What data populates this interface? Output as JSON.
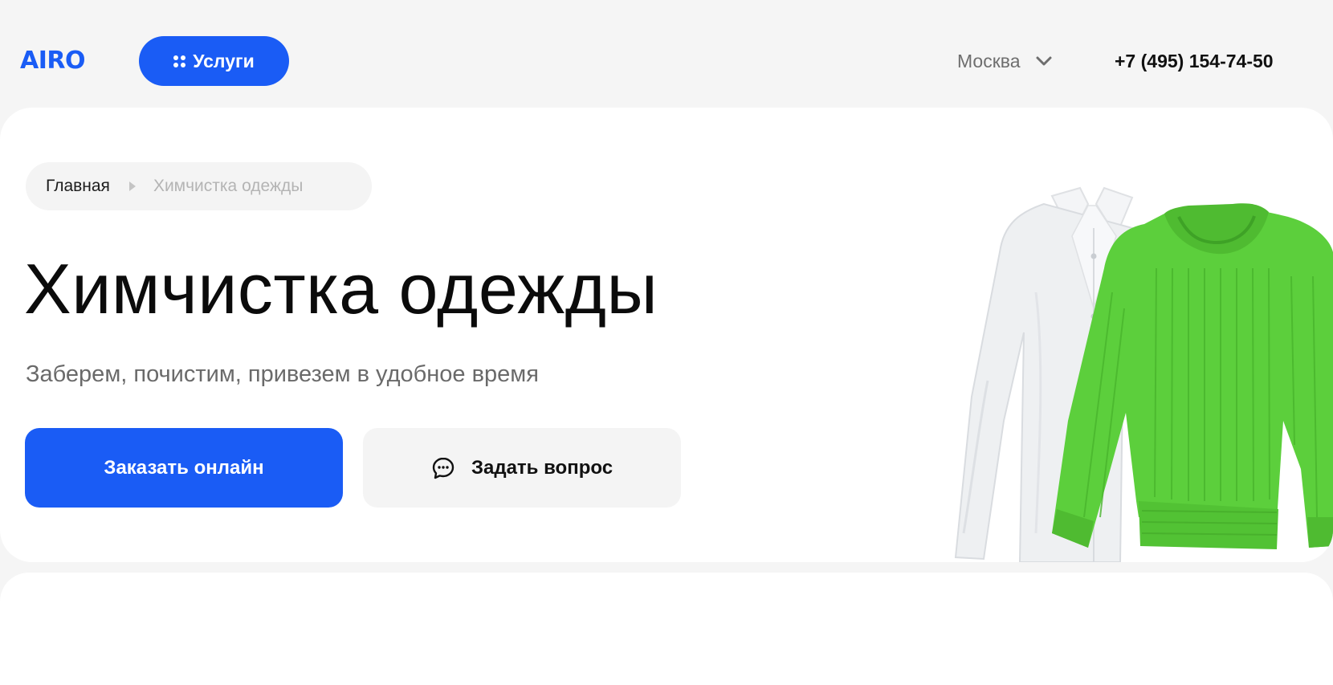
{
  "header": {
    "logo_text": "AIRO",
    "services_label": "Услуги",
    "city_label": "Москва",
    "phone": "+7 (495) 154-74-50"
  },
  "breadcrumb": {
    "home": "Главная",
    "current": "Химчистка одежды"
  },
  "hero": {
    "title": "Химчистка одежды",
    "subtitle": "Заберем, почистим, привезем в удобное время",
    "order_button": "Заказать онлайн",
    "ask_button": "Задать вопрос"
  },
  "icons": {
    "services": "grid-dots-icon",
    "city_dropdown": "chevron-down-icon",
    "breadcrumb_separator": "caret-right-icon",
    "ask": "chat-bubble-icon"
  },
  "colors": {
    "accent": "#1a5cf5",
    "page_bg": "#f5f5f5",
    "card_bg": "#ffffff",
    "sweater": "#5ccf3c",
    "shirt": "#eef0f2"
  }
}
